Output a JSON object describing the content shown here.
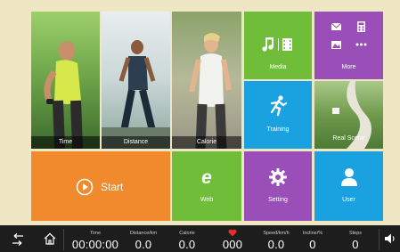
{
  "tiles": {
    "time": "Time",
    "distance": "Distance",
    "calorie": "Calorie",
    "media": "Media",
    "more": "More",
    "training": "Training",
    "real_scene": "Real Scene",
    "start": "Start",
    "web": "Web",
    "setting": "Setting",
    "user": "User"
  },
  "colors": {
    "background": "#efe6c4",
    "start": "#f08a2c",
    "green": "#6fbd38",
    "purple": "#9a4fb8",
    "blue": "#1aa1df",
    "bar": "#1d1d1d",
    "heart": "#e03030"
  },
  "icons": [
    "back-arrow-icon",
    "home-icon",
    "music-icon",
    "film-icon",
    "mail-icon",
    "calculator-icon",
    "image-icon",
    "ellipsis-icon",
    "runner-icon",
    "play-circle-icon",
    "browser-e-icon",
    "gear-icon",
    "user-icon",
    "heart-icon",
    "speaker-icon"
  ],
  "status": {
    "time_label": "Time",
    "time_value": "00:00:00",
    "distance_label": "Distance/km",
    "distance_value": "0.0",
    "calorie_label": "Calorie",
    "calorie_value": "0.0",
    "heart_value": "000",
    "speed_label": "Speed/km/h",
    "speed_value": "0.0",
    "incline_label": "Incline/%",
    "incline_value": "0",
    "steps_label": "Steps",
    "steps_value": "0"
  }
}
